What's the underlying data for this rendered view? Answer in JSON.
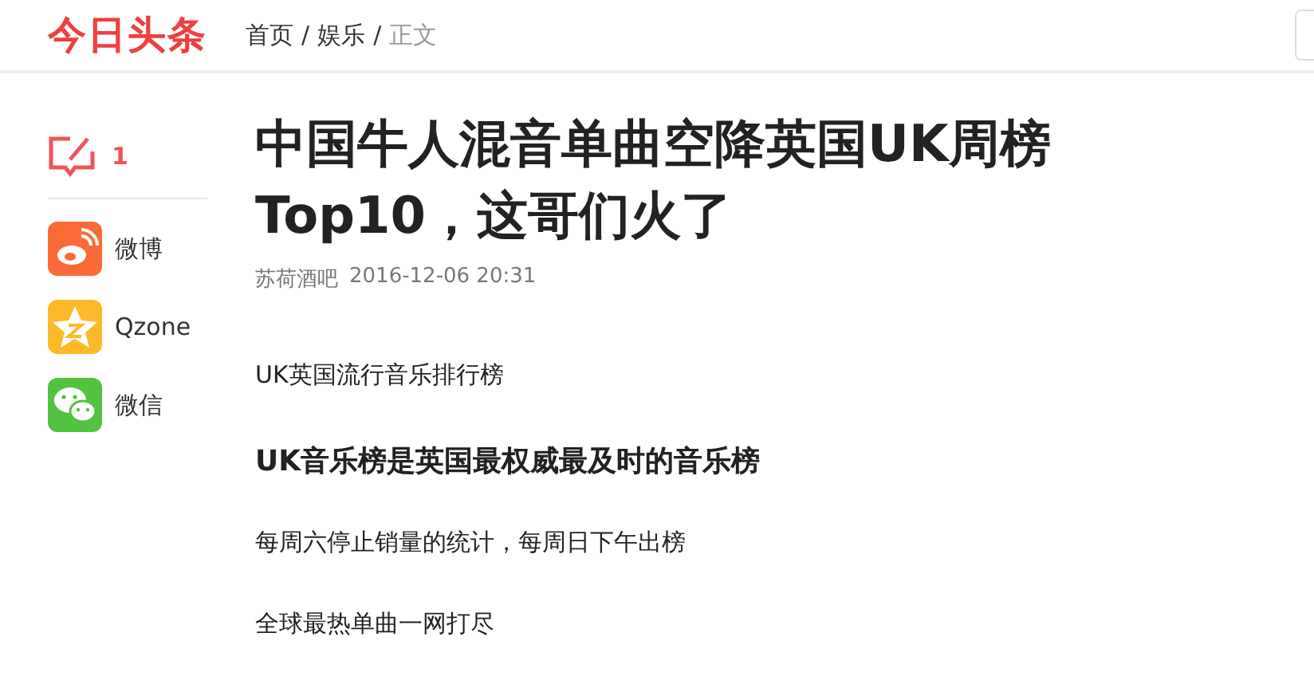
{
  "header": {
    "logo": "今日头条",
    "breadcrumb": [
      {
        "label": "首页",
        "current": false
      },
      {
        "label": "娱乐",
        "current": false
      },
      {
        "label": "正文",
        "current": true
      }
    ],
    "separator": "/"
  },
  "sidebar": {
    "comments": {
      "count": "1"
    },
    "share": [
      {
        "kind": "weibo",
        "label": "微博"
      },
      {
        "kind": "qzone",
        "label": "Qzone"
      },
      {
        "kind": "wechat",
        "label": "微信"
      }
    ]
  },
  "article": {
    "title": "中国牛人混音单曲空降英国UK周榜Top10，这哥们火了",
    "source": "苏荷酒吧",
    "time": "2016-12-06 20:31",
    "paragraphs": [
      {
        "kind": "text",
        "text": "UK英国流行音乐排行榜"
      },
      {
        "kind": "heading",
        "text": "UK音乐榜是英国最权威最及时的音乐榜"
      },
      {
        "kind": "text",
        "text": "每周六停止销量的统计，每周日下午出榜"
      },
      {
        "kind": "text",
        "text": "全球最热单曲一网打尽"
      }
    ]
  }
}
